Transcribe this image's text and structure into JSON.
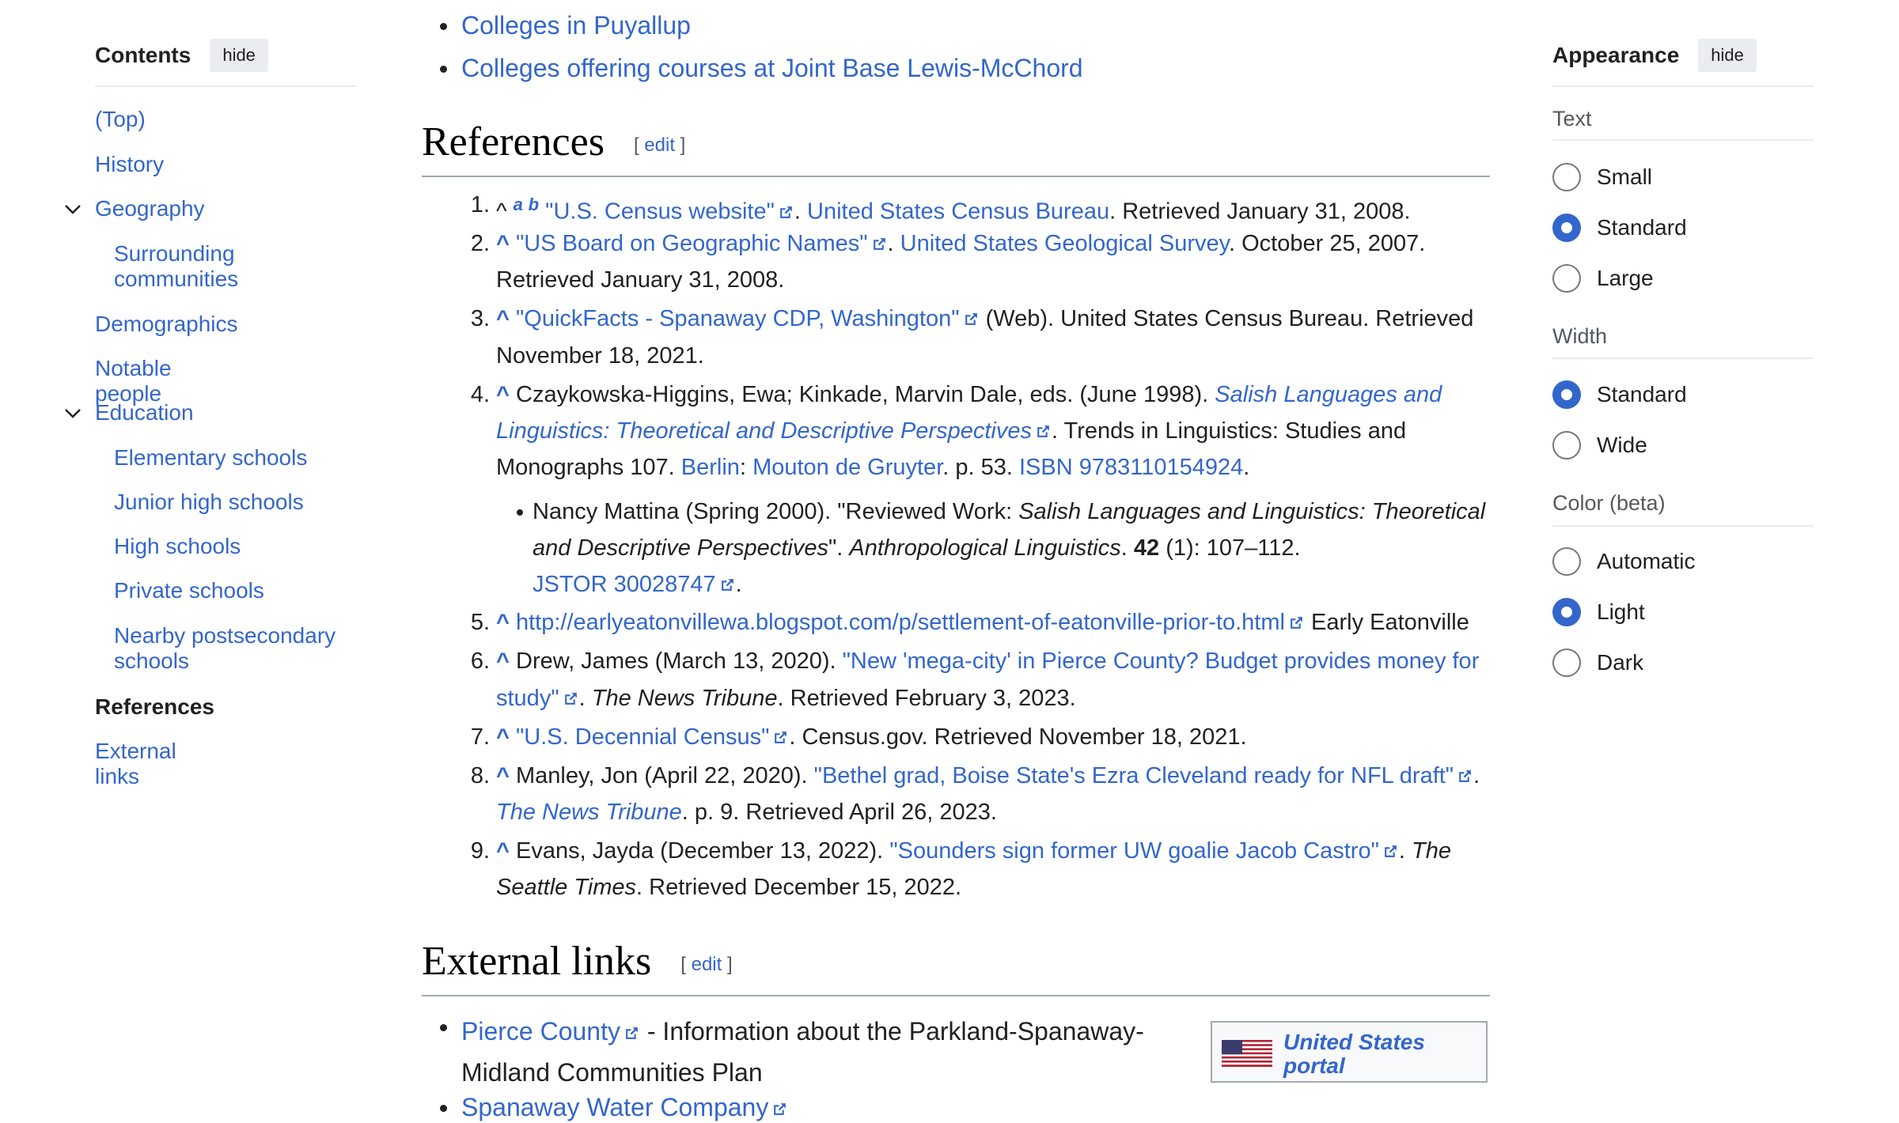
{
  "toc": {
    "title": "Contents",
    "hide": "hide",
    "items": [
      {
        "label": "(Top)"
      },
      {
        "label": "History"
      },
      {
        "label": "Geography"
      },
      {
        "label": "Surrounding communities"
      },
      {
        "label": "Demographics"
      },
      {
        "label": "Notable people"
      },
      {
        "label": "Education"
      },
      {
        "label": "Elementary schools"
      },
      {
        "label": "Junior high schools"
      },
      {
        "label": "High schools"
      },
      {
        "label": "Private schools"
      },
      {
        "label": "Nearby postsecondary schools"
      },
      {
        "label": "References"
      },
      {
        "label": "External links"
      }
    ]
  },
  "main": {
    "top_list": [
      "Colleges in Puyallup",
      "Colleges offering courses at Joint Base Lewis-McChord"
    ],
    "references_heading": "References",
    "edit": "edit",
    "refs": {
      "r1": {
        "a": "a",
        "b": "b",
        "link": "\"U.S. Census website\"",
        "pub": "United States Census Bureau",
        "tail": ". Retrieved January 31, 2008."
      },
      "r2": {
        "link": "\"US Board on Geographic Names\"",
        "pub": "United States Geological Survey",
        "tail1": ". October 25, 2007.",
        "tail2": "Retrieved January 31, 2008."
      },
      "r3": {
        "link": "\"QuickFacts - Spanaway CDP, Washington\"",
        "tail1": " (Web). United States Census Bureau. Retrieved",
        "tail2": "November 18, 2021."
      },
      "r4": {
        "authors": "Czaykowska-Higgins, Ewa; Kinkade, Marvin Dale, eds. (June 1998). ",
        "title1": "Salish Languages and",
        "title2": "Linguistics: Theoretical and Descriptive Perspectives",
        "tail2": ". Trends in Linguistics: Studies and",
        "l3a": "Monographs 107. ",
        "berlin": "Berlin",
        "mouton": "Mouton de Gruyter",
        "p53": ". p. 53. ",
        "isbn": "ISBN 9783110154924",
        "dot": ".",
        "sub1a": "Nancy Mattina (Spring 2000). \"Reviewed Work: ",
        "sub1b": "Salish Languages and Linguistics: Theoretical",
        "sub2a": "and Descriptive Perspectives",
        "sub2b": "\". ",
        "sub2c": "Anthropological Linguistics",
        "sub2d": ". ",
        "sub2e": "42",
        "sub2f": " (1): 107–112.",
        "jstor": "JSTOR 30028747",
        "jdot": "."
      },
      "r5": {
        "link": "http://earlyeatonvillewa.blogspot.com/p/settlement-of-eatonville-prior-to.html",
        "tail": " Early Eatonville"
      },
      "r6": {
        "pre": "Drew, James (March 13, 2020). ",
        "link1": "\"New 'mega-city' in Pierce County? Budget provides money for",
        "link2": "study\"",
        "dot": ". ",
        "pub": "The News Tribune",
        "tail": ". Retrieved February 3, 2023."
      },
      "r7": {
        "link": "\"U.S. Decennial Census\"",
        "tail": ". Census.gov. Retrieved November 18, 2021."
      },
      "r8": {
        "pre": "Manley, Jon (April 22, 2020). ",
        "link": "\"Bethel grad, Boise State's Ezra Cleveland ready for NFL draft\"",
        "dot": ".",
        "pub": "The News Tribune",
        "tail": ". p. 9. Retrieved April 26, 2023."
      },
      "r9": {
        "pre": "Evans, Jayda (December 13, 2022). ",
        "link": "\"Sounders sign former UW goalie Jacob Castro\"",
        "dot": ". ",
        "pub1": "The",
        "pub2": "Seattle Times",
        "tail": ". Retrieved December 15, 2022."
      }
    },
    "nums": [
      "1.",
      "2.",
      "3.",
      "4.",
      "5.",
      "6.",
      "7.",
      "8.",
      "9."
    ],
    "caret": "^",
    "external_heading": "External links",
    "ext1": {
      "link": "Pierce County",
      "text1": " - Information about the Parkland-Spanaway-",
      "text2": "Midland Communities Plan"
    },
    "ext2": {
      "link": "Spanaway Water Company"
    },
    "portal": {
      "line1": "United States",
      "line2": "portal"
    }
  },
  "appearance": {
    "title": "Appearance",
    "hide": "hide",
    "text_label": "Text",
    "text_options": [
      "Small",
      "Standard",
      "Large"
    ],
    "text_selected": "Standard",
    "width_label": "Width",
    "width_options": [
      "Standard",
      "Wide"
    ],
    "width_selected": "Standard",
    "color_label": "Color (beta)",
    "color_options": [
      "Automatic",
      "Light",
      "Dark"
    ],
    "color_selected": "Light"
  },
  "colors": {
    "link": "#3366cc",
    "text": "#202122",
    "radio_on": "#3366cc"
  }
}
